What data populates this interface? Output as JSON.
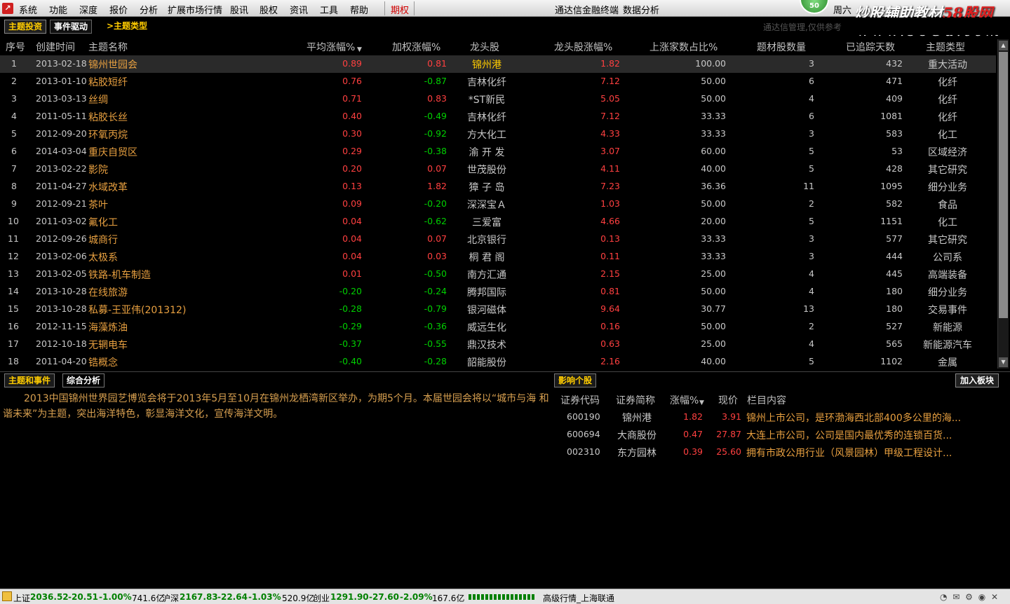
{
  "menu": {
    "items": [
      "系统",
      "功能",
      "深度",
      "报价",
      "分析",
      "扩展市场行情",
      "股讯",
      "股权",
      "资讯",
      "工具",
      "帮助"
    ],
    "qiquan": "期权",
    "center": [
      "通达信金融终端",
      "数据分析"
    ],
    "circle": "50",
    "day": "周六"
  },
  "watermark": {
    "line1a": "炒股辅助教材",
    "line1b": "58股网",
    "line2": "www.58Gu.com"
  },
  "tabs": {
    "t1": "主题投资",
    "t2": "事件驱动",
    "t3": ">主题类型"
  },
  "hint": "通达信管理,仅供参考",
  "headers": [
    "序号",
    "创建时间",
    "主题名称",
    "平均涨幅%",
    "加权涨幅%",
    "龙头股",
    "龙头股涨幅%",
    "上涨家数占比%",
    "题材股数量",
    "已追踪天数",
    "主题类型"
  ],
  "rows": [
    {
      "no": "1",
      "date": "2013-02-18",
      "name": "锦州世园会",
      "avg": "0.89",
      "wavg": "0.81",
      "lead": "锦州港",
      "leadchg": "1.82",
      "up": "100.00",
      "cnt": "3",
      "days": "432",
      "type": "重大活动"
    },
    {
      "no": "2",
      "date": "2013-01-10",
      "name": "粘胶短纤",
      "avg": "0.76",
      "wavg": "-0.87",
      "lead": "吉林化纤",
      "leadchg": "7.12",
      "up": "50.00",
      "cnt": "6",
      "days": "471",
      "type": "化纤"
    },
    {
      "no": "3",
      "date": "2013-03-13",
      "name": "丝绸",
      "avg": "0.71",
      "wavg": "0.83",
      "lead": "*ST新民",
      "leadchg": "5.05",
      "up": "50.00",
      "cnt": "4",
      "days": "409",
      "type": "化纤"
    },
    {
      "no": "4",
      "date": "2011-05-11",
      "name": "粘胶长丝",
      "avg": "0.40",
      "wavg": "-0.49",
      "lead": "吉林化纤",
      "leadchg": "7.12",
      "up": "33.33",
      "cnt": "6",
      "days": "1081",
      "type": "化纤"
    },
    {
      "no": "5",
      "date": "2012-09-20",
      "name": "环氧丙烷",
      "avg": "0.30",
      "wavg": "-0.92",
      "lead": "方大化工",
      "leadchg": "4.33",
      "up": "33.33",
      "cnt": "3",
      "days": "583",
      "type": "化工"
    },
    {
      "no": "6",
      "date": "2014-03-04",
      "name": "重庆自贸区",
      "avg": "0.29",
      "wavg": "-0.38",
      "lead": "渝 开 发",
      "leadchg": "3.07",
      "up": "60.00",
      "cnt": "5",
      "days": "53",
      "type": "区域经济"
    },
    {
      "no": "7",
      "date": "2013-02-22",
      "name": "影院",
      "avg": "0.20",
      "wavg": "0.07",
      "lead": "世茂股份",
      "leadchg": "4.11",
      "up": "40.00",
      "cnt": "5",
      "days": "428",
      "type": "其它研究"
    },
    {
      "no": "8",
      "date": "2011-04-27",
      "name": "水域改革",
      "avg": "0.13",
      "wavg": "1.82",
      "lead": "獐 子 岛",
      "leadchg": "7.23",
      "up": "36.36",
      "cnt": "11",
      "days": "1095",
      "type": "细分业务"
    },
    {
      "no": "9",
      "date": "2012-09-21",
      "name": "茶叶",
      "avg": "0.09",
      "wavg": "-0.20",
      "lead": "深深宝Ａ",
      "leadchg": "1.03",
      "up": "50.00",
      "cnt": "2",
      "days": "582",
      "type": "食品"
    },
    {
      "no": "10",
      "date": "2011-03-02",
      "name": "氟化工",
      "avg": "0.04",
      "wavg": "-0.62",
      "lead": "三爱富",
      "leadchg": "4.66",
      "up": "20.00",
      "cnt": "5",
      "days": "1151",
      "type": "化工"
    },
    {
      "no": "11",
      "date": "2012-09-26",
      "name": "城商行",
      "avg": "0.04",
      "wavg": "0.07",
      "lead": "北京银行",
      "leadchg": "0.13",
      "up": "33.33",
      "cnt": "3",
      "days": "577",
      "type": "其它研究"
    },
    {
      "no": "12",
      "date": "2013-02-06",
      "name": "太极系",
      "avg": "0.04",
      "wavg": "0.03",
      "lead": "桐 君 阁",
      "leadchg": "0.11",
      "up": "33.33",
      "cnt": "3",
      "days": "444",
      "type": "公司系"
    },
    {
      "no": "13",
      "date": "2013-02-05",
      "name": "铁路-机车制造",
      "avg": "0.01",
      "wavg": "-0.50",
      "lead": "南方汇通",
      "leadchg": "2.15",
      "up": "25.00",
      "cnt": "4",
      "days": "445",
      "type": "高端装备"
    },
    {
      "no": "14",
      "date": "2013-10-28",
      "name": "在线旅游",
      "avg": "-0.20",
      "wavg": "-0.24",
      "lead": "腾邦国际",
      "leadchg": "0.81",
      "up": "50.00",
      "cnt": "4",
      "days": "180",
      "type": "细分业务"
    },
    {
      "no": "15",
      "date": "2013-10-28",
      "name": "私募-王亚伟(201312)",
      "avg": "-0.28",
      "wavg": "-0.79",
      "lead": "银河磁体",
      "leadchg": "9.64",
      "up": "30.77",
      "cnt": "13",
      "days": "180",
      "type": "交易事件"
    },
    {
      "no": "16",
      "date": "2012-11-15",
      "name": "海藻炼油",
      "avg": "-0.29",
      "wavg": "-0.36",
      "lead": "威远生化",
      "leadchg": "0.16",
      "up": "50.00",
      "cnt": "2",
      "days": "527",
      "type": "新能源"
    },
    {
      "no": "17",
      "date": "2012-10-18",
      "name": "无辋电车",
      "avg": "-0.37",
      "wavg": "-0.55",
      "lead": "鼎汉技术",
      "leadchg": "0.63",
      "up": "25.00",
      "cnt": "4",
      "days": "565",
      "type": "新能源汽车"
    },
    {
      "no": "18",
      "date": "2011-04-20",
      "name": "锆概念",
      "avg": "-0.40",
      "wavg": "-0.28",
      "lead": "韶能股份",
      "leadchg": "2.16",
      "up": "40.00",
      "cnt": "5",
      "days": "1102",
      "type": "金属"
    }
  ],
  "bottom": {
    "tab1": "主题和事件",
    "tab2": "综合分析",
    "tab3": "影响个股",
    "add": "加入板块"
  },
  "description": "2013中国锦州世界园艺博览会将于2013年5月至10月在锦州龙栖湾新区举办，为期5个月。本届世园会将以“城市与海 和谐未来”为主题，突出海洋特色，彰显海洋文化，宣传海洋文明。",
  "stockHeaders": [
    "证券代码",
    "证券简称",
    "涨幅%",
    "现价",
    "栏目内容"
  ],
  "stocks": [
    {
      "code": "600190",
      "name": "锦州港",
      "chg": "1.82",
      "price": "3.91",
      "content": "锦州上市公司，是环渤海西北部400多公里的海..."
    },
    {
      "code": "600694",
      "name": "大商股份",
      "chg": "0.47",
      "price": "27.87",
      "content": "大连上市公司，公司是国内最优秀的连锁百货..."
    },
    {
      "code": "002310",
      "name": "东方园林",
      "chg": "0.39",
      "price": "25.60",
      "content": "拥有市政公用行业（风景园林）甲级工程设计..."
    }
  ],
  "status": {
    "sh_label": "上证",
    "sh_val": "2036.52",
    "sh_chg": "-20.51",
    "sh_pct": "-1.00%",
    "sh_amt": "741.6亿",
    "hs_label": "沪深",
    "hs_val": "2167.83",
    "hs_chg": "-22.64",
    "hs_pct": "-1.03%",
    "hs_amt": "520.9亿",
    "cy_label": "创业",
    "cy_val": "1291.90",
    "cy_chg": "-27.60",
    "cy_pct": "-2.09%",
    "cy_amt": "167.6亿",
    "feed": "高级行情_上海联通"
  }
}
